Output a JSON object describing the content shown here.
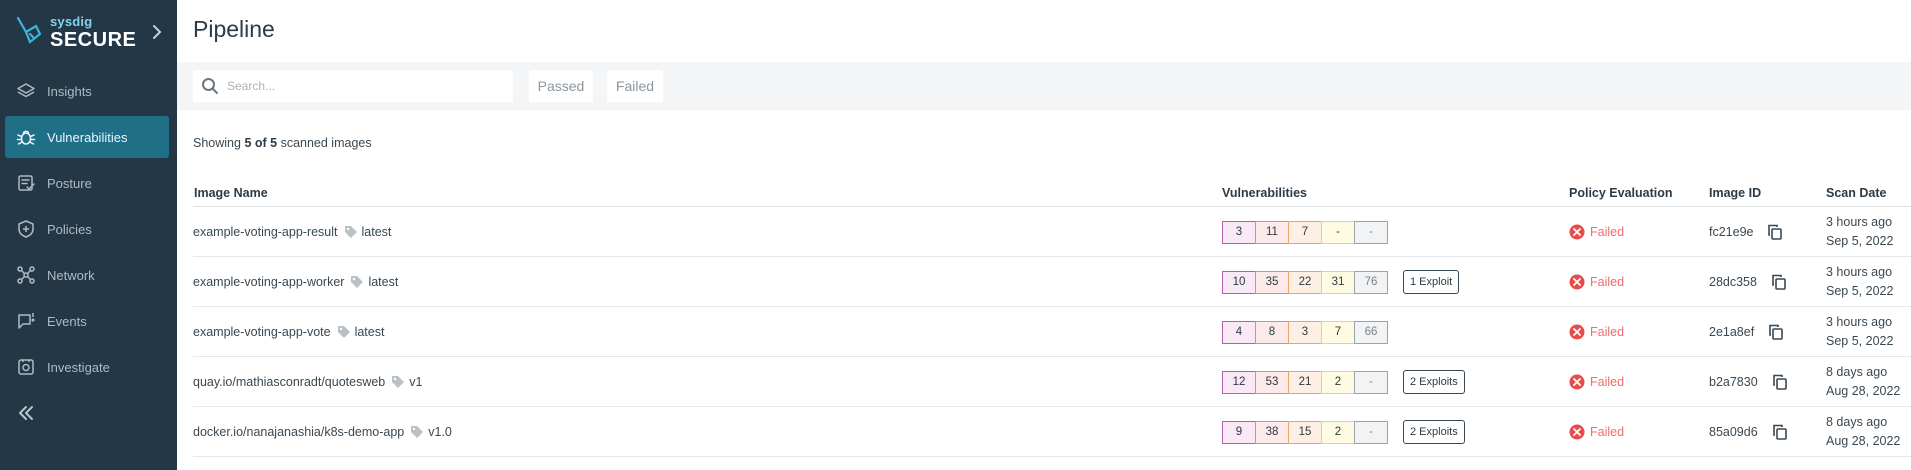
{
  "brand": {
    "sub": "sysdig",
    "main": "SECURE"
  },
  "nav": [
    {
      "label": "Insights",
      "icon": "layers-icon"
    },
    {
      "label": "Vulnerabilities",
      "icon": "bug-icon",
      "active": true
    },
    {
      "label": "Posture",
      "icon": "checklist-icon"
    },
    {
      "label": "Policies",
      "icon": "shield-icon"
    },
    {
      "label": "Network",
      "icon": "network-icon"
    },
    {
      "label": "Events",
      "icon": "chat-icon"
    },
    {
      "label": "Investigate",
      "icon": "camera-icon"
    }
  ],
  "page": {
    "title": "Pipeline"
  },
  "toolbar": {
    "search_placeholder": "Search...",
    "filter_passed": "Passed",
    "filter_failed": "Failed"
  },
  "summary": {
    "prefix": "Showing ",
    "count": "5 of 5",
    "suffix": " scanned images"
  },
  "table": {
    "headers": {
      "image_name": "Image Name",
      "vulnerabilities": "Vulnerabilities",
      "policy": "Policy Evaluation",
      "image_id": "Image ID",
      "scan_date": "Scan Date"
    },
    "rows": [
      {
        "name": "example-voting-app-result",
        "tag": "latest",
        "sev": [
          "3",
          "11",
          "7",
          "-",
          "-"
        ],
        "exploit": "",
        "policy": "Failed",
        "id": "fc21e9e",
        "date_rel": "3 hours ago",
        "date_abs": "Sep 5, 2022"
      },
      {
        "name": "example-voting-app-worker",
        "tag": "latest",
        "sev": [
          "10",
          "35",
          "22",
          "31",
          "76"
        ],
        "exploit": "1 Exploit",
        "policy": "Failed",
        "id": "28dc358",
        "date_rel": "3 hours ago",
        "date_abs": "Sep 5, 2022"
      },
      {
        "name": "example-voting-app-vote",
        "tag": "latest",
        "sev": [
          "4",
          "8",
          "3",
          "7",
          "66"
        ],
        "exploit": "",
        "policy": "Failed",
        "id": "2e1a8ef",
        "date_rel": "3 hours ago",
        "date_abs": "Sep 5, 2022"
      },
      {
        "name": "quay.io/mathiasconradt/quotesweb",
        "tag": "v1",
        "sev": [
          "12",
          "53",
          "21",
          "2",
          "-"
        ],
        "exploit": "2 Exploits",
        "policy": "Failed",
        "id": "b2a7830",
        "date_rel": "8 days ago",
        "date_abs": "Aug 28, 2022"
      },
      {
        "name": "docker.io/nanajanashia/k8s-demo-app",
        "tag": "v1.0",
        "sev": [
          "9",
          "38",
          "15",
          "2",
          "-"
        ],
        "exploit": "2 Exploits",
        "policy": "Failed",
        "id": "85a09d6",
        "date_rel": "8 days ago",
        "date_abs": "Aug 28, 2022"
      }
    ]
  },
  "colors": {
    "sidebar": "#243746",
    "active": "#1f6f86",
    "fail": "#ef6b6b"
  }
}
